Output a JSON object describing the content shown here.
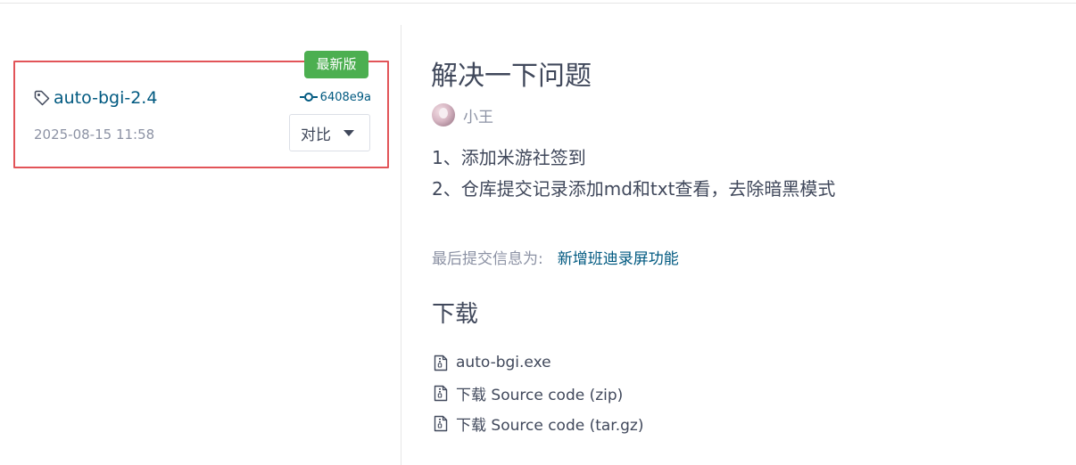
{
  "release": {
    "badge": "最新版",
    "tag": "auto-bgi-2.4",
    "commit": "6408e9a",
    "date": "2025-08-15 11:58",
    "compare_label": "对比"
  },
  "detail": {
    "title": "解决一下问题",
    "author": "小王",
    "notes": [
      "1、添加米游社签到",
      "2、仓库提交记录添加md和txt查看，去除暗黑模式"
    ],
    "commit_message_label": "最后提交信息为:",
    "commit_message": "新增班迪录屏功能",
    "download_heading": "下载",
    "downloads": [
      "auto-bgi.exe",
      "下载 Source code (zip)",
      "下载 Source code (tar.gz)"
    ]
  },
  "colors": {
    "highlight_border": "#e25458",
    "badge_bg": "#4caf50",
    "link": "#005980"
  },
  "icons": {
    "tag": "tag-icon",
    "commit": "commit-icon",
    "compare": "caret-down-icon",
    "file": "file-zip-icon"
  }
}
